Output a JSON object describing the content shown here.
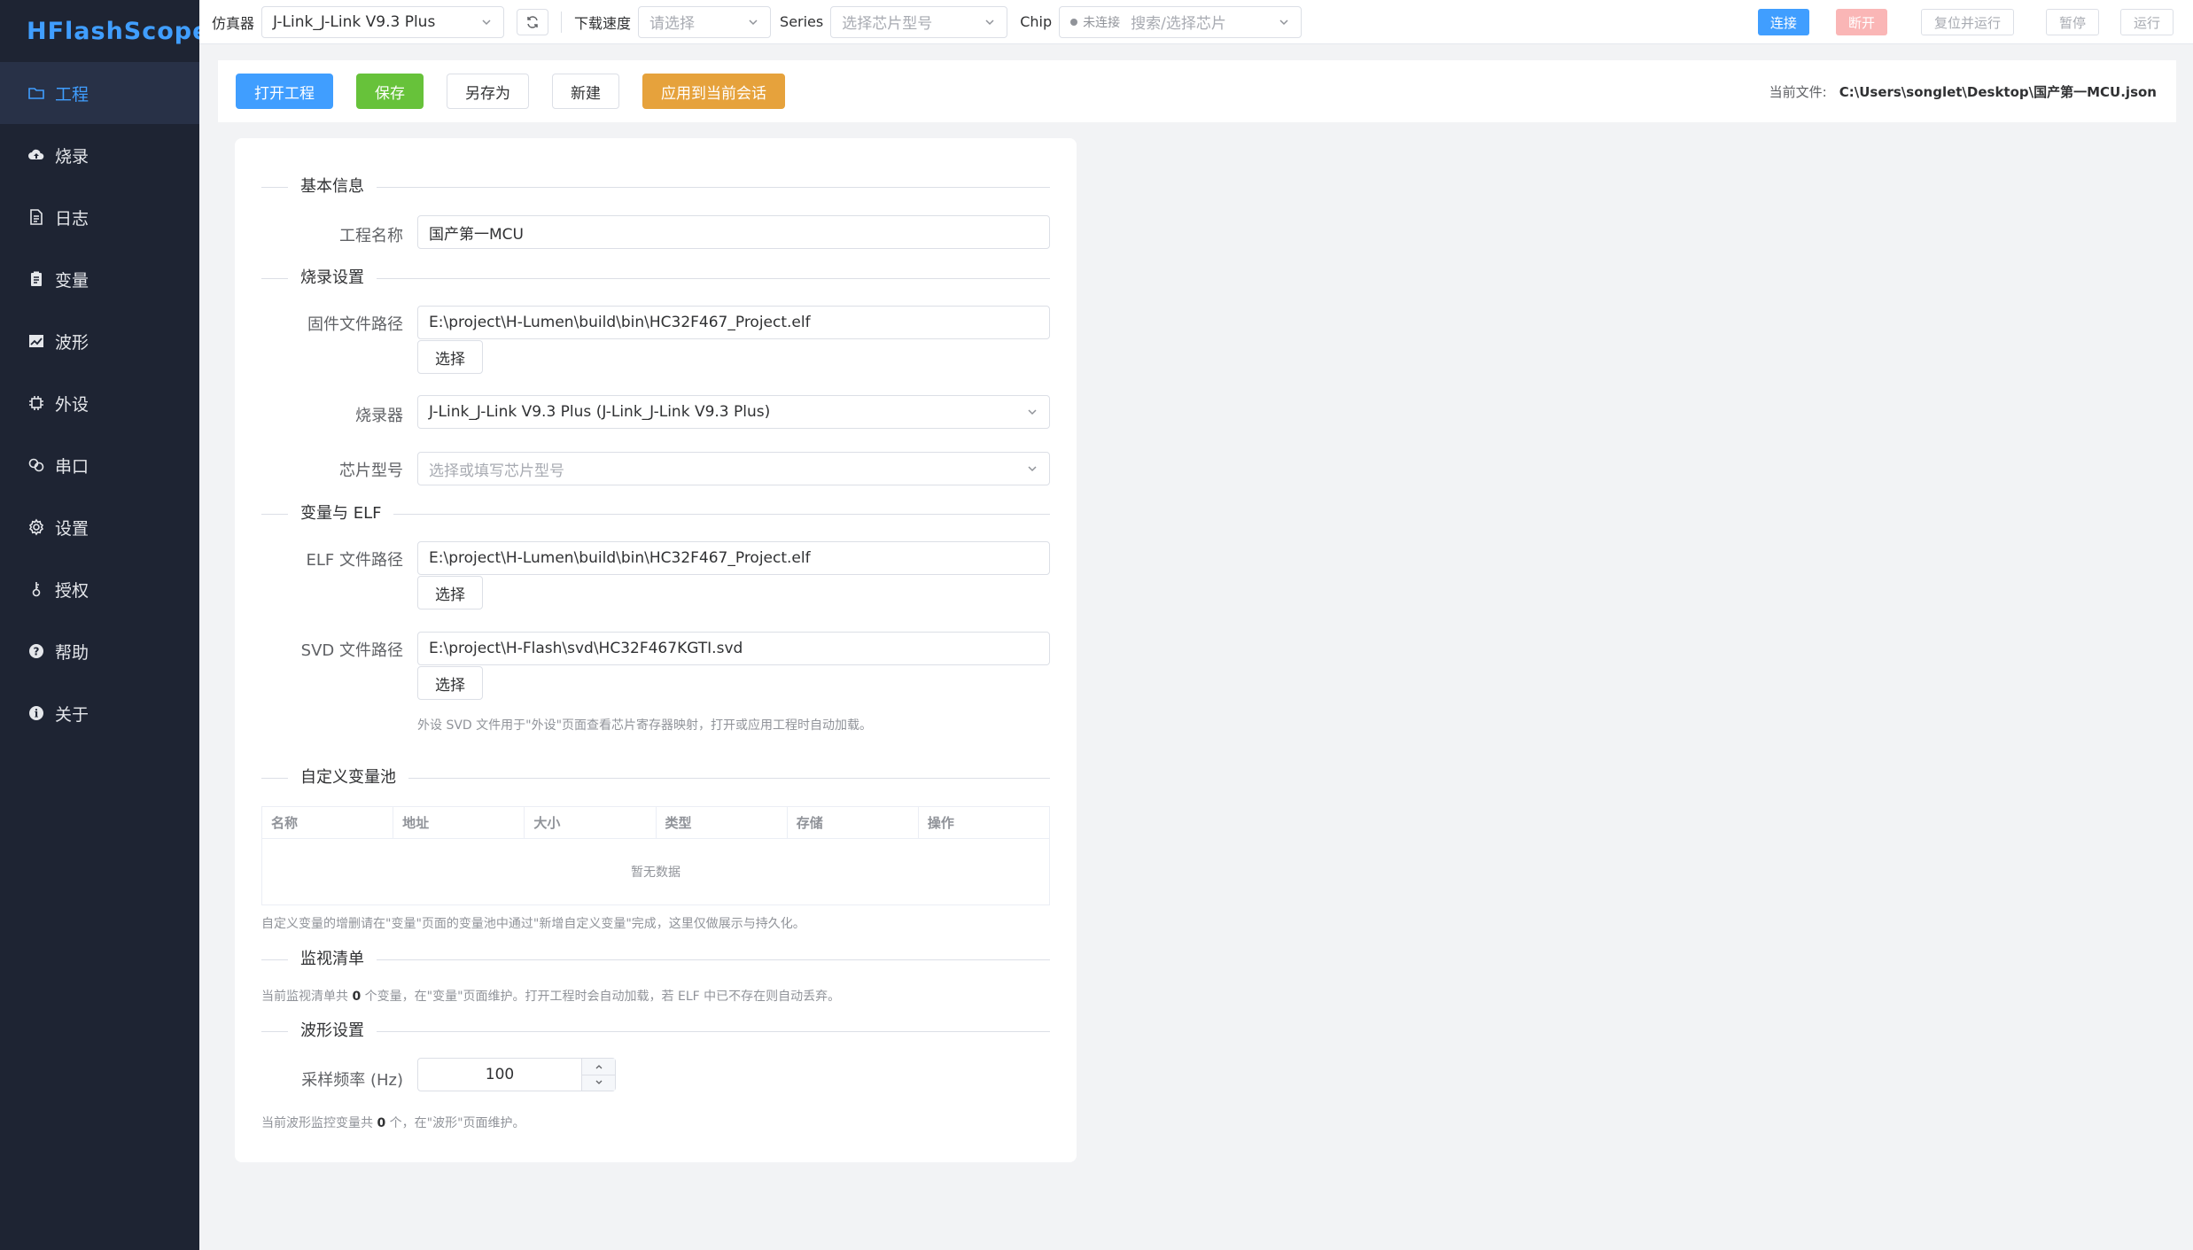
{
  "app": {
    "logo": "HFlashScope"
  },
  "sidebar": {
    "items": [
      {
        "label": "工程",
        "icon": "folder-icon",
        "active": true
      },
      {
        "label": "烧录",
        "icon": "cloud-upload-icon"
      },
      {
        "label": "日志",
        "icon": "document-icon"
      },
      {
        "label": "变量",
        "icon": "clipboard-icon"
      },
      {
        "label": "波形",
        "icon": "chart-icon"
      },
      {
        "label": "外设",
        "icon": "chip-icon"
      },
      {
        "label": "串口",
        "icon": "link-icon"
      },
      {
        "label": "设置",
        "icon": "gear-icon"
      },
      {
        "label": "授权",
        "icon": "key-icon"
      },
      {
        "label": "帮助",
        "icon": "question-icon"
      },
      {
        "label": "关于",
        "icon": "info-icon"
      }
    ]
  },
  "topbar": {
    "emulator_label": "仿真器",
    "emulator_value": "J-Link_J-Link V9.3 Plus",
    "speed_label": "下载速度",
    "speed_placeholder": "请选择",
    "series_label": "Series",
    "series_placeholder": "选择芯片型号",
    "chip_label": "Chip",
    "chip_status": "未连接",
    "chip_placeholder": "搜索/选择芯片",
    "connect": "连接",
    "disconnect": "断开",
    "reset_run": "复位并运行",
    "pause": "暂停",
    "run": "运行"
  },
  "actions": {
    "open": "打开工程",
    "save": "保存",
    "save_as": "另存为",
    "new": "新建",
    "apply": "应用到当前会话",
    "current_file_label": "当前文件:",
    "current_file": "C:\\Users\\songlet\\Desktop\\国产第一MCU.json"
  },
  "form": {
    "section_basic": "基本信息",
    "name_label": "工程名称",
    "name_value": "国产第一MCU",
    "section_flash": "烧录设置",
    "firmware_label": "固件文件路径",
    "firmware_value": "E:\\project\\H-Lumen\\build\\bin\\HC32F467_Project.elf",
    "choose": "选择",
    "programmer_label": "烧录器",
    "programmer_value": "J-Link_J-Link V9.3 Plus (J-Link_J-Link V9.3 Plus)",
    "chip_label": "芯片型号",
    "chip_placeholder": "选择或填写芯片型号",
    "section_elf": "变量与 ELF",
    "elf_label": "ELF 文件路径",
    "elf_value": "E:\\project\\H-Lumen\\build\\bin\\HC32F467_Project.elf",
    "svd_label": "SVD 文件路径",
    "svd_value": "E:\\project\\H-Flash\\svd\\HC32F467KGTI.svd",
    "svd_hint": "外设 SVD 文件用于\"外设\"页面查看芯片寄存器映射，打开或应用工程时自动加载。",
    "section_pool": "自定义变量池",
    "table_headers": [
      "名称",
      "地址",
      "大小",
      "类型",
      "存储",
      "操作"
    ],
    "table_empty": "暂无数据",
    "pool_hint": "自定义变量的增删请在\"变量\"页面的变量池中通过\"新增自定义变量\"完成，这里仅做展示与持久化。",
    "section_watch": "监视清单",
    "watch_hint_pre": "当前监视清单共",
    "watch_count": "0",
    "watch_hint_post": "个变量，在\"变量\"页面维护。打开工程时会自动加载，若 ELF 中已不存在则自动丢弃。",
    "section_wave": "波形设置",
    "rate_label": "采样频率 (Hz)",
    "rate_value": "100",
    "wave_hint_pre": "当前波形监控变量共",
    "wave_count": "0",
    "wave_hint_post": "个，在\"波形\"页面维护。"
  }
}
